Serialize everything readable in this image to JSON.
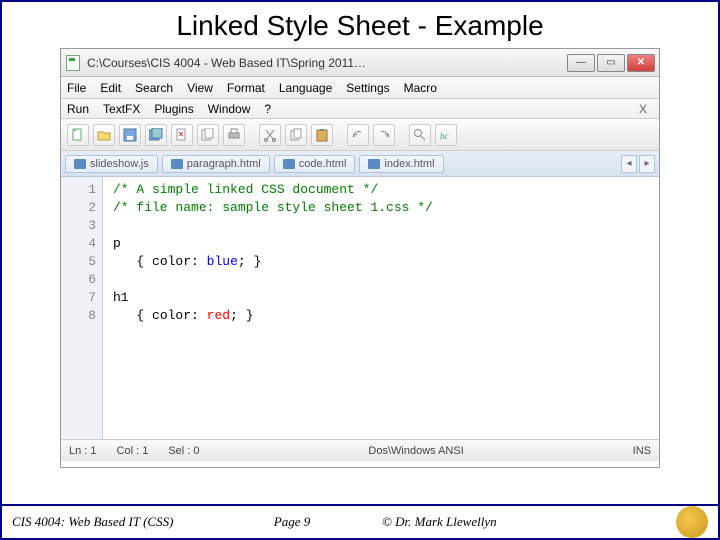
{
  "slide": {
    "title": "Linked Style Sheet - Example"
  },
  "window": {
    "title": "C:\\Courses\\CIS 4004 - Web Based IT\\Spring 2011…"
  },
  "menu1": {
    "file": "File",
    "edit": "Edit",
    "search": "Search",
    "view": "View",
    "format": "Format",
    "language": "Language",
    "settings": "Settings",
    "macro": "Macro"
  },
  "menu2": {
    "run": "Run",
    "textfx": "TextFX",
    "plugins": "Plugins",
    "window": "Window",
    "help": "?",
    "close": "X"
  },
  "tabs": {
    "t0": "slideshow.js",
    "t1": "paragraph.html",
    "t2": "code.html",
    "t3": "index.html"
  },
  "code": {
    "l1": {
      "comment": "/* A simple linked CSS document */"
    },
    "l2": {
      "comment": "/* file name: sample style sheet 1.css */"
    },
    "l4": {
      "sel": "p"
    },
    "l5": {
      "prop": "color",
      "val": "blue"
    },
    "l7": {
      "sel": "h1"
    },
    "l8": {
      "prop": "color",
      "val": "red"
    }
  },
  "status": {
    "ln": "Ln : 1",
    "col": "Col : 1",
    "sel": "Sel : 0",
    "enc": "Dos\\Windows   ANSI",
    "ins": "INS"
  },
  "footer": {
    "course": "CIS 4004: Web Based IT (CSS)",
    "page": "Page 9",
    "author": "© Dr. Mark Llewellyn"
  }
}
